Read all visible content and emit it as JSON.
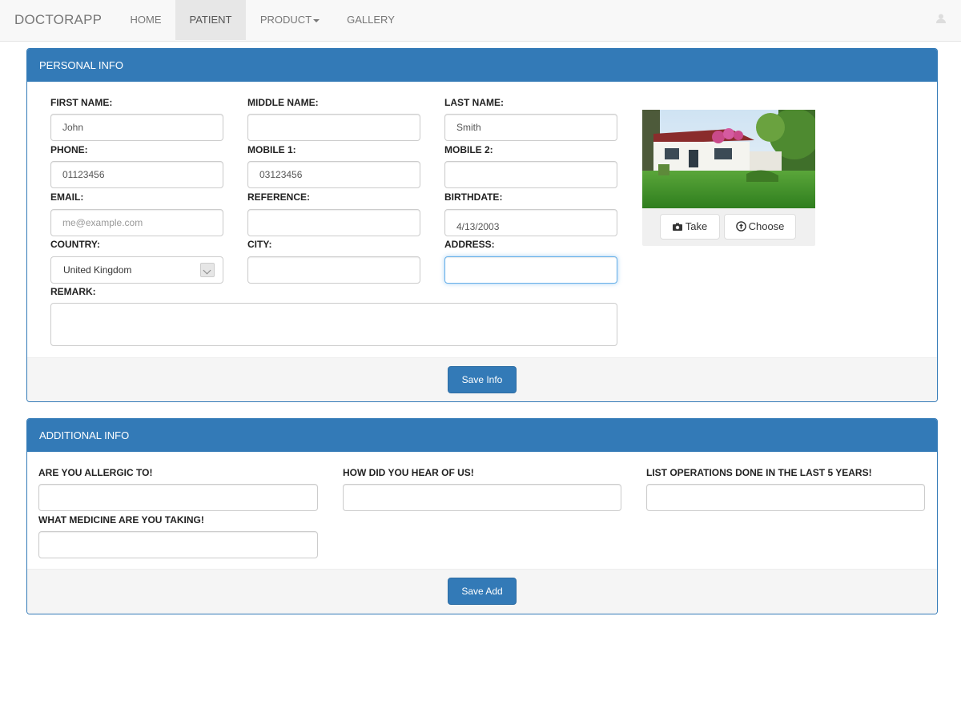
{
  "nav": {
    "brand": "DOCTORAPP",
    "items": [
      "HOME",
      "PATIENT",
      "PRODUCT",
      "GALLERY"
    ],
    "active": "PATIENT"
  },
  "personal": {
    "heading": "PERSONAL INFO",
    "labels": {
      "first_name": "FIRST NAME:",
      "middle_name": "MIDDLE NAME:",
      "last_name": "LAST NAME:",
      "phone": "PHONE:",
      "mobile1": "MOBILE 1:",
      "mobile2": "MOBILE 2:",
      "email": "EMAIL:",
      "reference": "REFERENCE:",
      "birthdate": "BIRTHDATE:",
      "country": "COUNTRY:",
      "city": "CITY:",
      "address": "ADDRESS:",
      "remark": "REMARK:"
    },
    "values": {
      "first_name": "John",
      "middle_name": "",
      "last_name": "Smith",
      "phone": "01123456",
      "mobile1": "03123456",
      "mobile2": "",
      "email": "",
      "reference": "",
      "birthdate": "4/13/2003",
      "country": "United Kingdom",
      "city": "",
      "address": "",
      "remark": ""
    },
    "placeholders": {
      "email": "me@example.com"
    },
    "photo_buttons": {
      "take": "Take",
      "choose": "Choose"
    },
    "save_label": "Save Info"
  },
  "additional": {
    "heading": "ADDITIONAL INFO",
    "labels": {
      "allergic": "ARE YOU ALLERGIC TO!",
      "hear": "HOW DID YOU HEAR OF US!",
      "operations": "LIST OPERATIONS DONE IN THE LAST 5 YEARS!",
      "medicine": "WHAT MEDICINE ARE YOU TAKING!"
    },
    "save_label": "Save Add"
  },
  "colors": {
    "primary": "#337ab7",
    "navbar_bg": "#f8f8f8",
    "active_nav_bg": "#e7e7e7"
  }
}
